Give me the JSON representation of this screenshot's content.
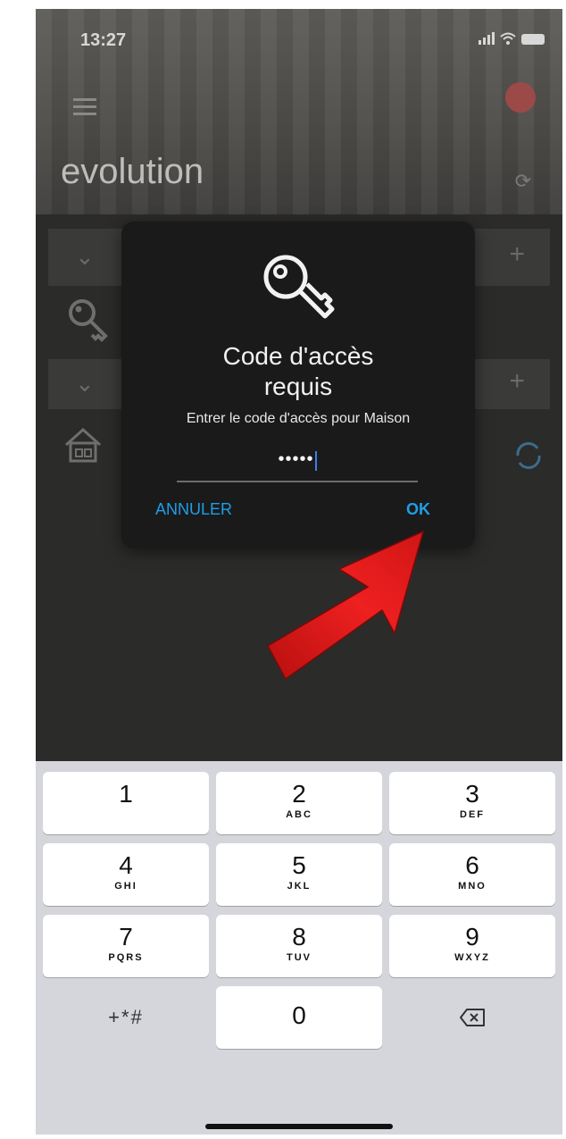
{
  "status_bar": {
    "time": "13:27"
  },
  "app": {
    "title": "evolution"
  },
  "dialog": {
    "title": "Code d'accès requis",
    "subtitle": "Entrer le code d'accès pour Maison",
    "code_value": "•••••",
    "cancel_label": "ANNULER",
    "ok_label": "OK",
    "icon": "key-icon"
  },
  "keyboard": {
    "keys": [
      {
        "digit": "1",
        "letters": ""
      },
      {
        "digit": "2",
        "letters": "ABC"
      },
      {
        "digit": "3",
        "letters": "DEF"
      },
      {
        "digit": "4",
        "letters": "GHI"
      },
      {
        "digit": "5",
        "letters": "JKL"
      },
      {
        "digit": "6",
        "letters": "MNO"
      },
      {
        "digit": "7",
        "letters": "PQRS"
      },
      {
        "digit": "8",
        "letters": "TUV"
      },
      {
        "digit": "9",
        "letters": "WXYZ"
      },
      {
        "digit": "0",
        "letters": ""
      }
    ],
    "symbols_label": "+*#",
    "delete_icon": "backspace-icon"
  },
  "colors": {
    "accent": "#1f9ee8",
    "dialog_bg": "#1a1a1a",
    "arrow": "#e31b1b"
  }
}
